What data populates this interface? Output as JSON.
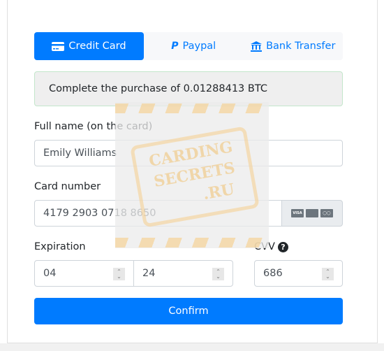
{
  "tabs": [
    {
      "label": "Credit Card",
      "icon": "credit-card-icon"
    },
    {
      "label": "Paypal",
      "icon": "paypal-icon"
    },
    {
      "label": "Bank Transfer",
      "icon": "bank-icon"
    }
  ],
  "alert": "Complete the purchase of 0.01288413 BTC",
  "form": {
    "full_name_label": "Full name (on the card)",
    "full_name": "Emily Williams",
    "card_number_label": "Card number",
    "card_number": "4179 2903 0718 8650",
    "card_brands": [
      "VISA",
      "AMEX",
      "MASTERCARD"
    ],
    "expiration_label": "Expiration",
    "exp_month": "04",
    "exp_year": "24",
    "cvv_label": "CVV",
    "cvv": "686",
    "confirm": "Confirm"
  },
  "watermark": "CARDING SECRETS .RU",
  "colors": {
    "primary": "#007bff"
  }
}
